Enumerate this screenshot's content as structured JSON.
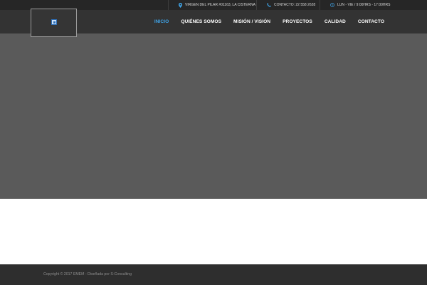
{
  "topbar": {
    "address": "VIRGEN DEL PILAR #01163, LA CISTERNA",
    "contact": "CONTACTO: 22 558 2628",
    "hours": "LUN - VIE / 9:00HRS - 17:00HRS",
    "icon_color": "#3fa3e6"
  },
  "header": {
    "nav": [
      {
        "label": "INICIO",
        "active": true
      },
      {
        "label": "QUIÉNES SOMOS"
      },
      {
        "label": "MISIÓN / VISIÓN"
      },
      {
        "label": "PROYECTOS"
      },
      {
        "label": "CALIDAD"
      },
      {
        "label": "CONTACTO"
      }
    ],
    "active_color": "#3fa3e6"
  },
  "hero": {
    "background": "#5a5a5a"
  },
  "footer": {
    "copyright": "Copyright © 2017 EMEM - Diseñada por S-Consulting"
  }
}
